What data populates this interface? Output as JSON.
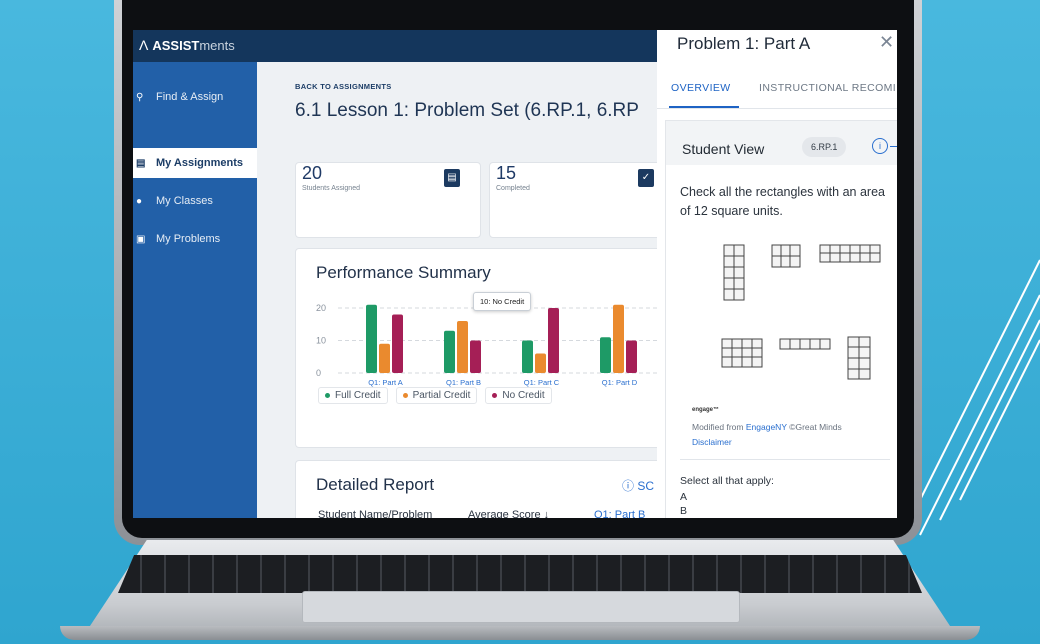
{
  "brand": {
    "bold": "ASSIST",
    "thin": "ments"
  },
  "sidebar": {
    "items": [
      {
        "label": "Find & Assign",
        "icon": "search-icon"
      },
      {
        "label": "My Assignments",
        "icon": "clipboard-icon"
      },
      {
        "label": "My Classes",
        "icon": "people-icon"
      },
      {
        "label": "My Problems",
        "icon": "folder-icon"
      }
    ]
  },
  "main": {
    "back_label": "BACK TO ASSIGNMENTS",
    "title": "6.1 Lesson 1: Problem Set (6.RP.1, 6.RP",
    "stats": [
      {
        "value": "20",
        "label": "Students Assigned"
      },
      {
        "value": "15",
        "label": "Completed"
      }
    ],
    "performance_title": "Performance Summary",
    "legend": [
      "Full Credit",
      "Partial Credit",
      "No Credit"
    ],
    "tooltip": "10: No Credit",
    "detailed_title": "Detailed Report",
    "detailed_link": "SC",
    "detailed_cols": [
      "Student Name/Problem",
      "Average Score",
      "Q1: Part B"
    ]
  },
  "chart_data": {
    "type": "bar",
    "categories": [
      "Q1: Part A",
      "Q1: Part B",
      "Q1: Part C",
      "Q1: Part D"
    ],
    "series": [
      {
        "name": "Full Credit",
        "color": "#1e9a66",
        "values": [
          21,
          13,
          10,
          11
        ]
      },
      {
        "name": "Partial Credit",
        "color": "#ea8a2e",
        "values": [
          9,
          16,
          6,
          21
        ]
      },
      {
        "name": "No Credit",
        "color": "#a51f56",
        "values": [
          18,
          10,
          20,
          10
        ]
      }
    ],
    "yticks": [
      0,
      10,
      20
    ],
    "ylim": [
      0,
      24
    ],
    "grid": true,
    "legend_position": "bottom-left"
  },
  "panel": {
    "title": "Problem 1: Part A",
    "close_icon": "close-icon",
    "tabs": [
      "OVERVIEW",
      "INSTRUCTIONAL RECOMI"
    ],
    "student_view": "Student View",
    "badge": "6.RP.1",
    "info_icon": "i",
    "question": "Check all the rectangles with an area of 12 square units.",
    "engage": "engage™",
    "credit_prefix": "Modified from",
    "credit_link": "EngageNY",
    "credit_suffix": "©Great Minds",
    "disclaimer": "Disclaimer",
    "select_label": "Select all that apply:",
    "options": [
      "A",
      "B"
    ]
  },
  "colors": {
    "sidebar": "#2260a8",
    "topbar": "#14365c",
    "accent": "#1e63c4"
  }
}
